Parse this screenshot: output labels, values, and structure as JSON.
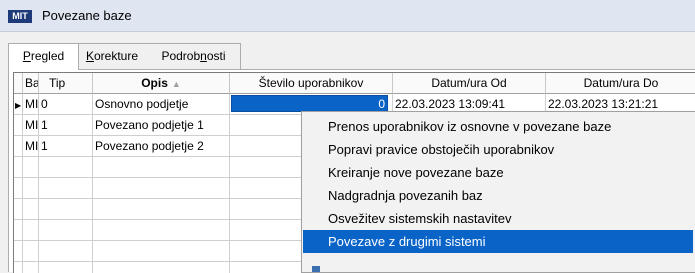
{
  "window": {
    "logo": "MIT",
    "title": "Povezane baze"
  },
  "tabs": [
    {
      "label_pre": "",
      "label_u": "P",
      "label_post": "regled",
      "active": true
    },
    {
      "label_pre": "",
      "label_u": "K",
      "label_post": "orekture",
      "active": false
    },
    {
      "label_pre": "Podrob",
      "label_u": "n",
      "label_post": "osti",
      "active": false
    }
  ],
  "grid": {
    "columns": {
      "ba": "Ba",
      "tip": "Tip",
      "opis": "Opis",
      "stevilo": "Število uporabnikov",
      "od": "Datum/ura Od",
      "do": "Datum/ura Do"
    },
    "sort_icon": "sort-ascending-icon",
    "current_row_indicator": "▶",
    "rows": [
      {
        "ba": "MI",
        "tip": "0",
        "opis": "Osnovno podjetje",
        "stevilo": "0",
        "od": "22.03.2023 13:09:41",
        "do": "22.03.2023 13:21:21"
      },
      {
        "ba": "MI",
        "tip": "1",
        "opis": "Povezano podjetje 1",
        "stevilo": "",
        "od": "",
        "do": ""
      },
      {
        "ba": "MI",
        "tip": "1",
        "opis": "Povezano podjetje 2",
        "stevilo": "",
        "od": "",
        "do": ""
      }
    ]
  },
  "context_menu": {
    "items": [
      "Prenos uporabnikov iz osnovne v povezane baze",
      "Popravi pravice obstoječih uporabnikov",
      "Kreiranje nove povezane baze",
      "Nadgradnja povezanih baz",
      "Osvežitev sistemskih nastavitev",
      "Povezave z drugimi sistemi"
    ],
    "highlighted_index": 5
  },
  "colors": {
    "selection": "#0a64c8",
    "titlebar": "#dfe6f2",
    "logo_bg": "#1e3a78"
  }
}
